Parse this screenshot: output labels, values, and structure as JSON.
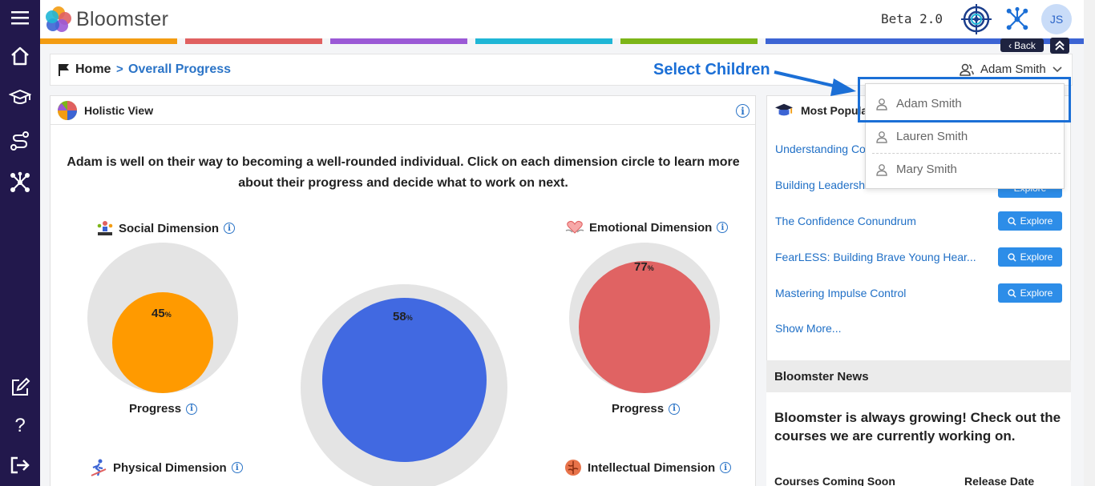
{
  "app": {
    "name": "Bloomster",
    "version": "Beta 2.0",
    "user_initials": "JS",
    "back_label": "Back"
  },
  "colors": {
    "nav_bg": "#22184c",
    "accent": "#2b74c7",
    "bar1": "#f39c12",
    "bar2": "#e06060",
    "bar3": "#9b59d6",
    "bar4": "#1fb6d6",
    "bar5": "#7cb518",
    "bar6": "#3c64d4"
  },
  "breadcrumb": {
    "home": "Home",
    "separator": ">",
    "current": "Overall Progress"
  },
  "child_selector": {
    "selected": "Adam Smith",
    "options": [
      "Adam Smith",
      "Lauren Smith",
      "Mary Smith"
    ]
  },
  "annotation": {
    "label": "Select Children"
  },
  "holistic": {
    "title": "Holistic View",
    "intro": "Adam is well on their way to becoming a well-rounded individual. Click on each dimension circle to learn more about their progress and decide what to work on next.",
    "progress_label": "Progress",
    "pct_unit": "%",
    "dimensions": [
      {
        "name": "Social Dimension",
        "value": 45,
        "color": "#ff9a00"
      },
      {
        "name": "Emotional Dimension",
        "value": 77,
        "color": "#e06363"
      },
      {
        "name": "Physical Dimension"
      },
      {
        "name": "Intellectual Dimension"
      }
    ],
    "overall": {
      "value": 58,
      "color": "#4169e1"
    }
  },
  "popular": {
    "title": "Most Popula",
    "explore_label": "Explore",
    "items": [
      {
        "title": "Understanding Co"
      },
      {
        "title": "Building Leadershi"
      },
      {
        "title": "The Confidence Conundrum"
      },
      {
        "title": "FearLESS: Building Brave Young Hear..."
      },
      {
        "title": "Mastering Impulse Control"
      }
    ],
    "show_more": "Show More..."
  },
  "news": {
    "title": "Bloomster News",
    "text": "Bloomster is always growing! Check out the courses we are currently working on.",
    "col1": "Courses Coming Soon",
    "col2": "Release Date"
  }
}
